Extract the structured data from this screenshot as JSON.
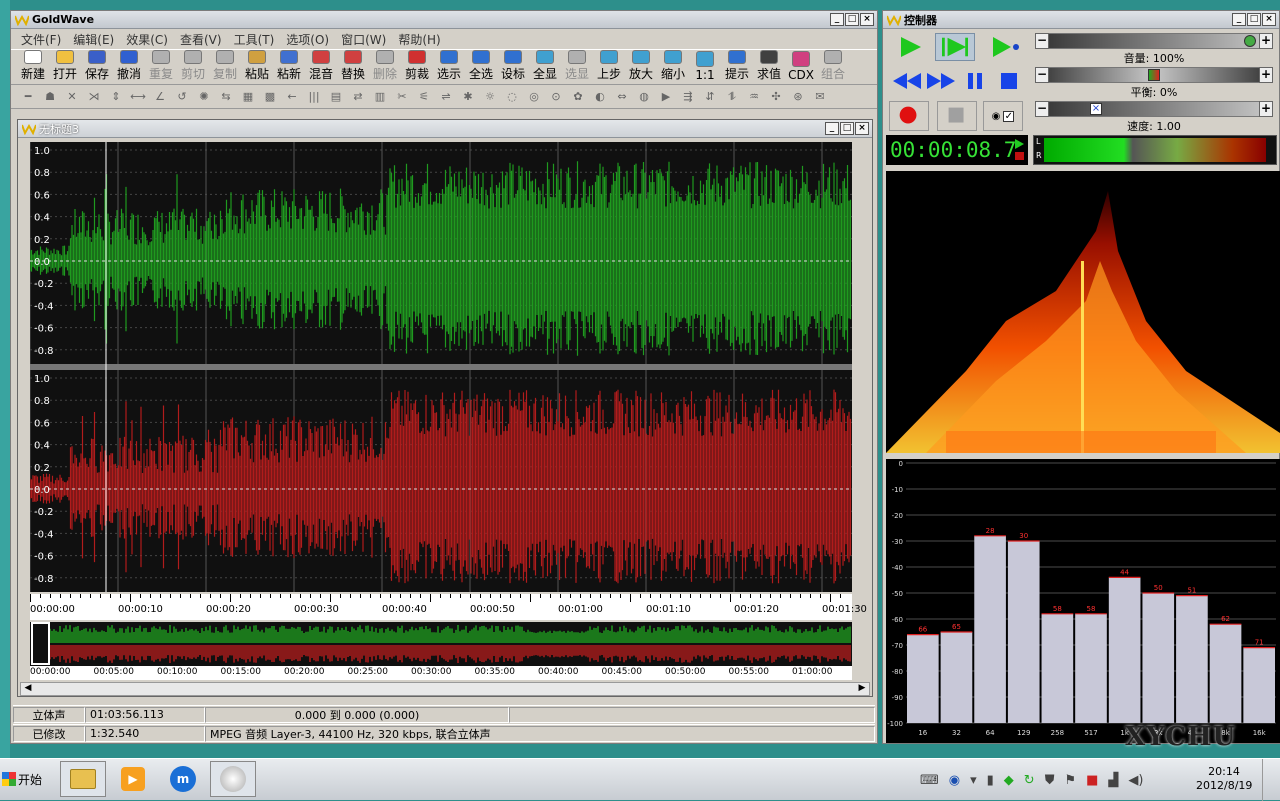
{
  "main": {
    "title": "GoldWave",
    "menu": [
      "文件(F)",
      "编辑(E)",
      "效果(C)",
      "查看(V)",
      "工具(T)",
      "选项(O)",
      "窗口(W)",
      "帮助(H)"
    ],
    "toolbar": [
      {
        "label": "新建",
        "enabled": true,
        "icon": "new-file-icon",
        "color": "#ffffff"
      },
      {
        "label": "打开",
        "enabled": true,
        "icon": "open-folder-icon",
        "color": "#f0c040"
      },
      {
        "label": "保存",
        "enabled": true,
        "icon": "save-disk-icon",
        "color": "#3a5fc8"
      },
      {
        "label": "撤消",
        "enabled": true,
        "icon": "undo-icon",
        "color": "#3060d0"
      },
      {
        "label": "重复",
        "enabled": false,
        "icon": "redo-icon",
        "color": "#b0b0b0"
      },
      {
        "label": "剪切",
        "enabled": false,
        "icon": "scissors-icon",
        "color": "#b0b0b0"
      },
      {
        "label": "复制",
        "enabled": false,
        "icon": "copy-icon",
        "color": "#b0b0b0"
      },
      {
        "label": "粘贴",
        "enabled": true,
        "icon": "paste-icon",
        "color": "#d0a040"
      },
      {
        "label": "粘新",
        "enabled": true,
        "icon": "paste-new-icon",
        "color": "#4070d0"
      },
      {
        "label": "混音",
        "enabled": true,
        "icon": "mix-icon",
        "color": "#d04040"
      },
      {
        "label": "替换",
        "enabled": true,
        "icon": "replace-icon",
        "color": "#d04040"
      },
      {
        "label": "删除",
        "enabled": false,
        "icon": "delete-icon",
        "color": "#b0b0b0"
      },
      {
        "label": "剪裁",
        "enabled": true,
        "icon": "trim-icon",
        "color": "#d03030"
      },
      {
        "label": "选示",
        "enabled": true,
        "icon": "select-view-icon",
        "color": "#3070d0"
      },
      {
        "label": "全选",
        "enabled": true,
        "icon": "select-all-icon",
        "color": "#3070d0"
      },
      {
        "label": "设标",
        "enabled": true,
        "icon": "set-marker-icon",
        "color": "#3070d0"
      },
      {
        "label": "全显",
        "enabled": true,
        "icon": "zoom-all-icon",
        "color": "#40a0d0"
      },
      {
        "label": "选显",
        "enabled": false,
        "icon": "zoom-selection-icon",
        "color": "#b0b0b0"
      },
      {
        "label": "上步",
        "enabled": true,
        "icon": "zoom-previous-icon",
        "color": "#40a0d0"
      },
      {
        "label": "放大",
        "enabled": true,
        "icon": "zoom-in-icon",
        "color": "#40a0d0"
      },
      {
        "label": "缩小",
        "enabled": true,
        "icon": "zoom-out-icon",
        "color": "#40a0d0"
      },
      {
        "label": "1:1",
        "enabled": true,
        "icon": "zoom-1-1-icon",
        "color": "#40a0d0"
      },
      {
        "label": "提示",
        "enabled": true,
        "icon": "cue-icon",
        "color": "#3070d0"
      },
      {
        "label": "求值",
        "enabled": true,
        "icon": "evaluate-fx-icon",
        "color": "#404040"
      },
      {
        "label": "CDX",
        "enabled": true,
        "icon": "cd-extract-icon",
        "color": "#d04080"
      },
      {
        "label": "组合",
        "enabled": false,
        "icon": "combine-icon",
        "color": "#b0b0b0"
      }
    ],
    "doc": {
      "title": "无标题3",
      "y_ticks": [
        "1.0",
        "0.8",
        "0.6",
        "0.4",
        "0.2",
        "0.0",
        "-0.2",
        "-0.4",
        "-0.6",
        "-0.8"
      ],
      "time_ticks": [
        "00:00:00",
        "00:00:10",
        "00:00:20",
        "00:00:30",
        "00:00:40",
        "00:00:50",
        "00:01:00",
        "00:01:10",
        "00:01:20",
        "00:01:30"
      ],
      "overview_ticks": [
        "00:00:00",
        "00:05:00",
        "00:10:00",
        "00:15:00",
        "00:20:00",
        "00:25:00",
        "00:30:00",
        "00:35:00",
        "00:40:00",
        "00:45:00",
        "00:50:00",
        "00:55:00",
        "01:00:00"
      ],
      "left_color": "#1f9a1f",
      "right_color": "#b01c1c"
    },
    "status": {
      "channel": "立体声",
      "length": "01:03:56.113",
      "selection": "0.000 到 0.000 (0.000)",
      "state": "已修改",
      "position": "1:32.540",
      "format": "MPEG 音频 Layer-3, 44100 Hz, 320 kbps, 联合立体声"
    }
  },
  "controller": {
    "title": "控制器",
    "volume_label": "音量: 100%",
    "balance_label": "平衡: 0%",
    "speed_label": "速度: 1.00",
    "time": "00:00:08.7",
    "meter_labels": [
      "L",
      "R"
    ],
    "eq_bands": [
      "16",
      "32",
      "64",
      "129",
      "258",
      "517",
      "1k",
      "2k",
      "4k",
      "8k",
      "16k"
    ],
    "eq_values": [
      -66,
      -65,
      -28,
      -30,
      -58,
      -58,
      -44,
      -50,
      -51,
      -62,
      -71
    ],
    "eq_y_ticks": [
      "0",
      "-10",
      "-20",
      "-30",
      "-40",
      "-50",
      "-60",
      "-70",
      "-80",
      "-90",
      "-100"
    ]
  },
  "taskbar": {
    "start": "开始",
    "time": "20:14",
    "date": "2012/8/19"
  },
  "watermark": "XYCHU"
}
